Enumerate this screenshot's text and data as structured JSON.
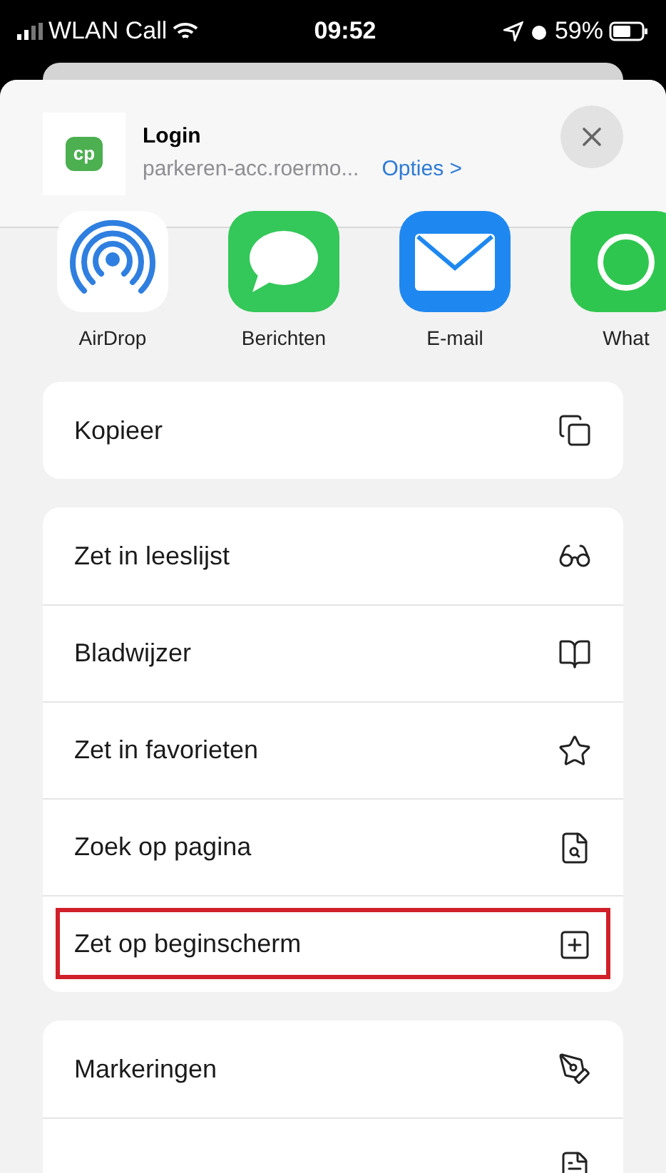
{
  "status_bar": {
    "carrier": "WLAN Call",
    "time": "09:52",
    "battery": "59%"
  },
  "header": {
    "title": "Login",
    "url": "parkeren-acc.roermo...",
    "options": "Opties >",
    "logo": "cp"
  },
  "share_targets": [
    {
      "kind": "airdrop",
      "label": "AirDrop"
    },
    {
      "kind": "messages",
      "label": "Berichten"
    },
    {
      "kind": "mail",
      "label": "E-mail"
    },
    {
      "kind": "whatsapp",
      "label": "What"
    }
  ],
  "action_groups": [
    [
      {
        "kind": "copy",
        "label": "Kopieer",
        "highlighted": false
      }
    ],
    [
      {
        "kind": "glasses",
        "label": "Zet in leeslijst",
        "highlighted": false
      },
      {
        "kind": "book",
        "label": "Bladwijzer",
        "highlighted": false
      },
      {
        "kind": "star",
        "label": "Zet in favorieten",
        "highlighted": false
      },
      {
        "kind": "find",
        "label": "Zoek op pagina",
        "highlighted": false
      },
      {
        "kind": "add",
        "label": "Zet op beginscherm",
        "highlighted": true
      }
    ],
    [
      {
        "kind": "markup",
        "label": "Markeringen",
        "highlighted": false
      },
      {
        "kind": "doc",
        "highlighted": false
      }
    ]
  ]
}
